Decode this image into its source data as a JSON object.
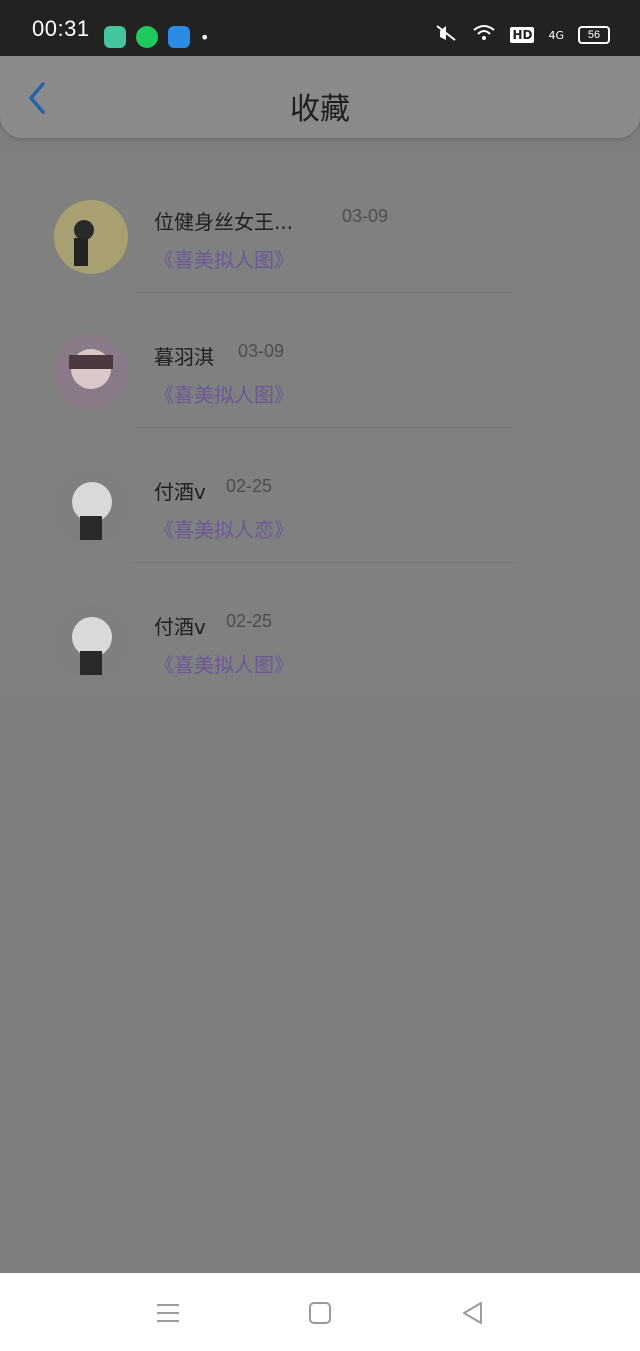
{
  "status_bar": {
    "time": "00:31",
    "app_icons": [
      "qiyu-icon",
      "wechat-icon",
      "paper-plane-icon"
    ],
    "dot": "•",
    "indicators": {
      "mute": "mute-icon",
      "wifi": "wifi-icon",
      "hd": "HD",
      "network": "4G",
      "battery": "56"
    }
  },
  "header": {
    "title": "收藏",
    "back_icon": "chevron-left-icon",
    "accent_color": "#1a73e8"
  },
  "favorites": [
    {
      "name": "位健身丝女王...",
      "time": "03-09",
      "book": "《喜美拟人图》"
    },
    {
      "name": "暮羽淇",
      "time": "03-09",
      "book": "《喜美拟人图》"
    },
    {
      "name": "付酒v",
      "time": "02-25",
      "book": "《喜美拟人恋》"
    },
    {
      "name": "付酒v",
      "time": "02-25",
      "book": "《喜美拟人图》"
    }
  ],
  "nav_bar": {
    "menu": "menu-icon",
    "home": "square-icon",
    "back": "triangle-back-icon"
  }
}
